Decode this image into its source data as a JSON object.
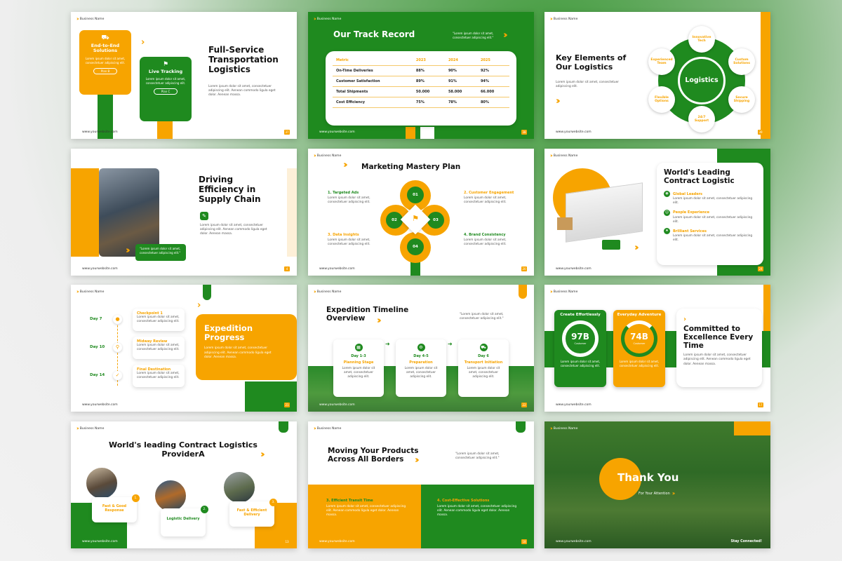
{
  "common": {
    "business": "Business Name",
    "website": "www.yourwebsite.com",
    "lorem": "Lorem ipsum dolor sit amet, consectetuer adipiscing elit. Aenean commodo ligula eget dolor. Aenean massa.",
    "lorem_short": "Lorem ipsum dolor sit amet, consectetuer adipiscing elit.",
    "quote": "\"Lorem ipsum dolor sit amet, consectetuer adipiscing elit.\""
  },
  "s1": {
    "title": "Full-Service Transportation Logistics",
    "card1_title": "End-to-End Solutions",
    "card1_text": "Lorem ipsum dolor sit amet, consectetuer adipiscing elit.",
    "card1_btn": "Plan B",
    "card2_title": "Live Tracking",
    "card2_text": "Lorem ipsum dolor sit amet, consectetuer adipiscing elit.",
    "card2_btn": "Plan C",
    "page": "37"
  },
  "s2": {
    "title": "Our Track Record",
    "header": [
      "Metric",
      "2023",
      "2024",
      "2025"
    ],
    "rows": [
      [
        "On-Time Deliveries",
        "88%",
        "90%",
        "92%"
      ],
      [
        "Customer Satisfaction",
        "89%",
        "91%",
        "94%"
      ],
      [
        "Total Shipments",
        "50.000",
        "58.000",
        "66.000"
      ],
      [
        "Cost Efficiency",
        "75%",
        "78%",
        "80%"
      ]
    ],
    "page": "38"
  },
  "s3": {
    "title": "Key Elements of Our Logistics",
    "center": "Logistics",
    "items": [
      "Innovative Tech",
      "Custom Solutions",
      "Secure Shipping",
      "24/7 Support",
      "Flexible Options",
      "Experienced Team"
    ],
    "page": "39"
  },
  "s4": {
    "title": "Driving Efficiency in Supply Chain",
    "page": "4"
  },
  "s5": {
    "title": "Marketing Mastery Plan",
    "items": [
      {
        "label": "1. Targeted Ads"
      },
      {
        "label": "2. Customer Engagement"
      },
      {
        "label": "3. Data Insights"
      },
      {
        "label": "4. Brand Consistency"
      }
    ],
    "nums": [
      "01",
      "02",
      "03",
      "04"
    ],
    "page": "20"
  },
  "s6": {
    "title": "World's Leading Contract Logistic",
    "items": [
      "Global Leaders",
      "People Experience",
      "Brilliant Services"
    ],
    "page": "24"
  },
  "s7": {
    "days": [
      "Day 7",
      "Day 10",
      "Day 14"
    ],
    "checkpoints": [
      "Checkpoint 1",
      "Midway Review",
      "Final Destination"
    ],
    "title": "Expedition Progress",
    "page": "21"
  },
  "s8": {
    "title": "Expedition Timeline Overview",
    "steps": [
      {
        "day": "Day 1-3",
        "name": "Planning Stage"
      },
      {
        "day": "Day 4-5",
        "name": "Preparation"
      },
      {
        "day": "Day 6",
        "name": "Transport Initiation"
      }
    ],
    "page": "22"
  },
  "s9": {
    "card1_title": "Create Effortlessly",
    "card1_value": "97B",
    "card2_title": "Everyday Adventure",
    "card2_value": "74B",
    "stat_label": "Customer",
    "title": "Committed to Excellence Every Time",
    "page": "17"
  },
  "s10": {
    "title": "World's leading Contract Logistics ProviderA",
    "items": [
      {
        "num": "1.",
        "label": "Fast & Good Response"
      },
      {
        "num": "2.",
        "label": "Logistic Delivery"
      },
      {
        "num": "3.",
        "label": "Fast & Efficient Delivery"
      }
    ],
    "page": "13"
  },
  "s11": {
    "title": "Moving Your Products Across All Borders",
    "item1": "3. Efficient Transit Time",
    "item2": "4. Cost-Effective Solutions",
    "page": "18"
  },
  "s12": {
    "title": "Thank You",
    "subtitle": "For Your Attention",
    "footer": "Stay Connected!"
  }
}
